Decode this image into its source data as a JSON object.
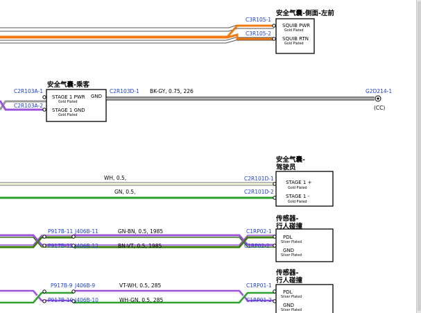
{
  "colors": {
    "orange": "#f07a10",
    "purple": "#9a54d8",
    "gray": "#9a9a9a",
    "green": "#2ea02e",
    "dark_green": "#3d7d10",
    "label_blue": "#1d3fd0",
    "black": "#000000"
  },
  "comp_left_airbag": {
    "title": "安全气囊-侧面-左前",
    "conn_pwr": "C3R105-1",
    "conn_rtn": "C3R105-2",
    "pin_pwr": "SQUIB PWR",
    "pin_pwr_plating": "Gold Plated",
    "pin_rtn": "SQUIB RTN",
    "pin_rtn_plating": "Gold Plated"
  },
  "comp_passenger": {
    "title": "安全气囊-乘客",
    "conn_in1": "C2R103A-1",
    "conn_in2": "C2R103A-2",
    "pin1": "STAGE 1 PWR",
    "pin1_plating": "Gold Plated",
    "pin2": "STAGE 1 GND",
    "pin2_plating": "Gold Plated",
    "gnd_label": "GND",
    "conn_out": "C2R103D-1",
    "wire_label": "BK-GY,  0.75,  226",
    "ground_id": "G2D214-1",
    "ground_note": "(CC)"
  },
  "comp_driver": {
    "title_line1": "安全气囊-",
    "title_line2": "驾驶员",
    "wire1_label": "WH,  0.5,",
    "wire2_label": "GN,  0.5,",
    "conn1": "C2R101D-1",
    "conn2": "C2R101D-2",
    "pin1": "STAGE 1 +",
    "pin1_plating": "Gold Plated",
    "pin2": "STAGE 1 -",
    "pin2_plating": "Gold Plated"
  },
  "comp_sensor1": {
    "title_line1": "传感器-",
    "title_line2": "行人碰撞",
    "splice1": "P917B-11",
    "splice1b": "J406B-11",
    "splice2": "P917B-12",
    "splice2b": "J406B-12",
    "wire1_label": "GN-BN,  0.5,  1985",
    "wire2_label": "BN-VT,  0.5,  1985",
    "conn1": "C1RP02-1",
    "conn2": "C1RP02-2",
    "pin1": "PDL",
    "pin1_plating": "Silver Plated",
    "pin2": "GND",
    "pin2_plating": "Silver Plated"
  },
  "comp_sensor2": {
    "title_line1": "传感器-",
    "title_line2": "行人碰撞",
    "splice1": "P917B-9",
    "splice1b": "J406B-9",
    "splice2": "P917B-10",
    "splice2b": "J406B-10",
    "wire1_label": "VT-WH,  0.5,  285",
    "wire2_label": "WH-GN,  0.5,  285",
    "conn1": "C1RP01-1",
    "conn2": "C1RP01-2",
    "pin1": "PDL",
    "pin1_plating": "Silver Plated",
    "pin2": "GND",
    "pin2_plating": "Silver Plated"
  }
}
